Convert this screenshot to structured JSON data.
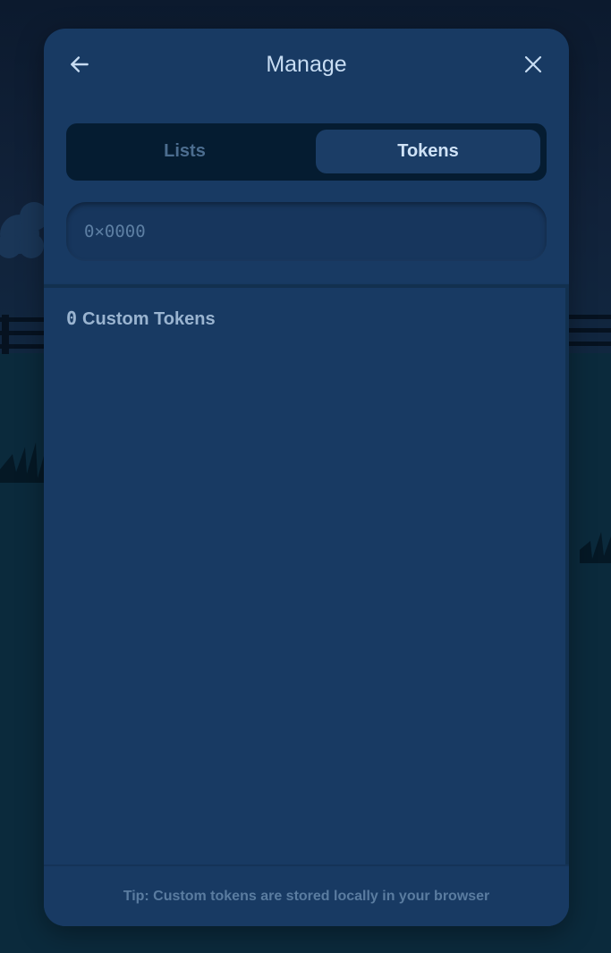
{
  "header": {
    "title": "Manage",
    "back_icon": "arrow-left-icon",
    "close_icon": "close-icon"
  },
  "tabs": [
    {
      "label": "Lists",
      "selected": false
    },
    {
      "label": "Tokens",
      "selected": true
    }
  ],
  "search": {
    "placeholder": "0×0000",
    "value": ""
  },
  "tokens": {
    "count": "0",
    "label": "Custom Tokens",
    "items": []
  },
  "footer": {
    "tip": "Tip: Custom tokens are stored locally in your browser"
  },
  "colors": {
    "modal_bg": "#183a63",
    "segmented_bg": "#051c31",
    "selected_tab_bg": "#1b3d66",
    "title_text": "#c7dcf2",
    "muted_text": "#5a7ca0"
  }
}
